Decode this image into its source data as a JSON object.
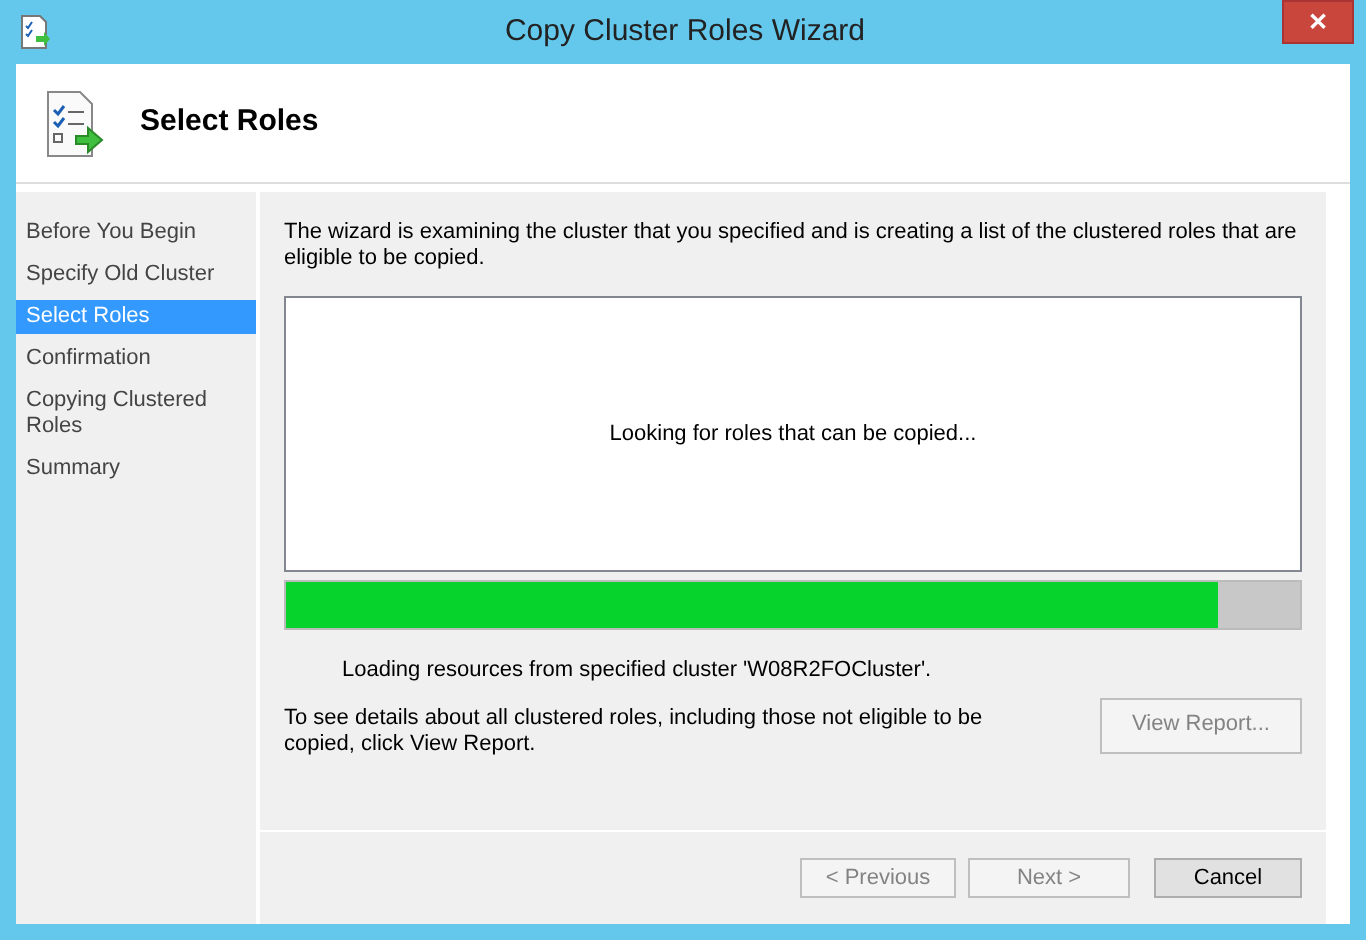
{
  "window": {
    "title": "Copy Cluster Roles Wizard",
    "close": "✕"
  },
  "header": {
    "title": "Select Roles"
  },
  "steps": [
    {
      "label": "Before You Begin",
      "selected": false
    },
    {
      "label": "Specify Old Cluster",
      "selected": false
    },
    {
      "label": "Select Roles",
      "selected": true
    },
    {
      "label": "Confirmation",
      "selected": false
    },
    {
      "label": "Copying Clustered Roles",
      "selected": false
    },
    {
      "label": "Summary",
      "selected": false
    }
  ],
  "description": "The wizard is examining the cluster that you specified and is creating a list of the clustered roles that are eligible to be copied.",
  "roles_list": {
    "message": "Looking for roles that can be copied..."
  },
  "progress": {
    "level": 0.92,
    "status": "Loading resources from specified cluster 'W08R2FOCluster'."
  },
  "report": {
    "text": "To see details about all clustered roles, including those not eligible to be copied, click View Report.",
    "button": {
      "label": "View Report...",
      "disabled": true
    }
  },
  "buttons": [
    {
      "label": "< Previous",
      "disabled": true
    },
    {
      "label": "Next >",
      "disabled": true
    },
    {
      "label": "Cancel",
      "disabled": false
    }
  ]
}
